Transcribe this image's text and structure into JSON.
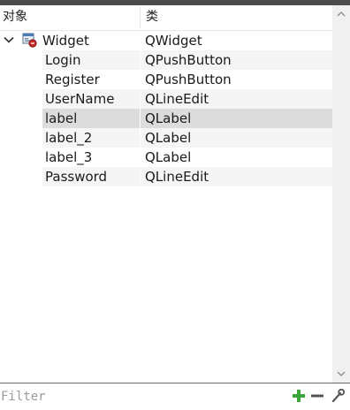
{
  "header": {
    "col_object": "对象",
    "col_class": "类"
  },
  "tree": {
    "root": {
      "name": "Widget",
      "class": "QWidget",
      "icon": "widget-icon"
    },
    "children": [
      {
        "name": "Login",
        "class": "QPushButton"
      },
      {
        "name": "Register",
        "class": "QPushButton"
      },
      {
        "name": "UserName",
        "class": "QLineEdit"
      },
      {
        "name": "label",
        "class": "QLabel"
      },
      {
        "name": "label_2",
        "class": "QLabel"
      },
      {
        "name": "label_3",
        "class": "QLabel"
      },
      {
        "name": "Password",
        "class": "QLineEdit"
      }
    ]
  },
  "filter": {
    "placeholder": "Filter",
    "value": ""
  },
  "selected": "label",
  "colors": {
    "selection": "#dcdcdc",
    "alternate_row": "#f5f5f5",
    "add_green": "#3aa63a",
    "topbar": "#4b4b4b"
  }
}
